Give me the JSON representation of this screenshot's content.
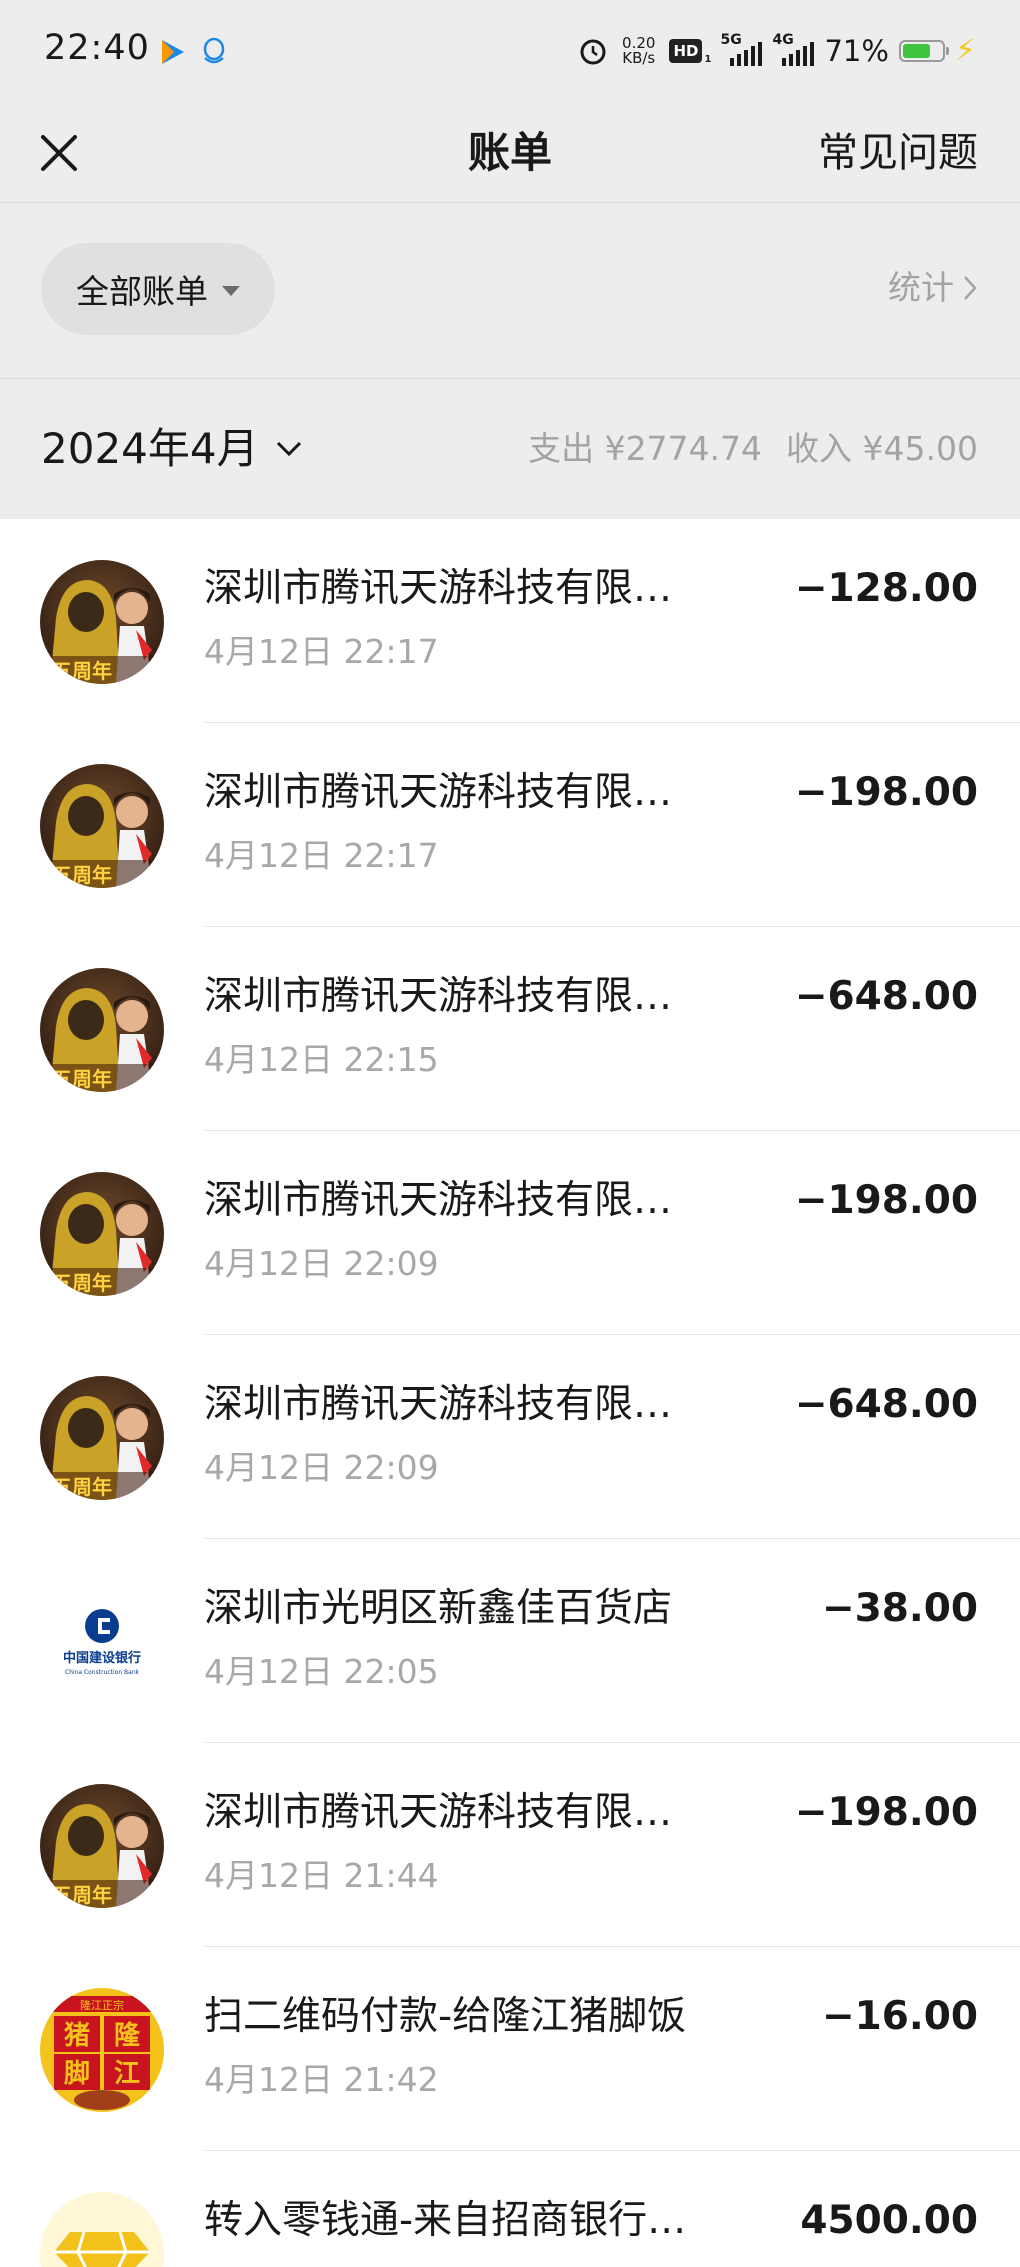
{
  "status_bar": {
    "time": "22:40",
    "net_speed_value": "0.20",
    "net_speed_unit": "KB/s",
    "hd_label": "HD",
    "hd_sub": "1",
    "signal_5g": "5G",
    "signal_4g": "4G",
    "battery_percent": "71%",
    "battery_level": 0.71
  },
  "navbar": {
    "title": "账单",
    "faq_label": "常见问题"
  },
  "filter": {
    "label": "全部账单",
    "stats_label": "统计"
  },
  "month": {
    "label": "2024年4月",
    "expense": "支出 ¥2774.74",
    "income": "收入 ¥45.00"
  },
  "transactions": [
    {
      "avatar": "game-avatar-icon",
      "name": "深圳市腾讯天游科技有限…",
      "time": "4月12日 22:17",
      "amount": "−128.00"
    },
    {
      "avatar": "game-avatar-icon",
      "name": "深圳市腾讯天游科技有限…",
      "time": "4月12日 22:17",
      "amount": "−198.00"
    },
    {
      "avatar": "game-avatar-icon",
      "name": "深圳市腾讯天游科技有限…",
      "time": "4月12日 22:15",
      "amount": "−648.00"
    },
    {
      "avatar": "game-avatar-icon",
      "name": "深圳市腾讯天游科技有限…",
      "time": "4月12日 22:09",
      "amount": "−198.00"
    },
    {
      "avatar": "game-avatar-icon",
      "name": "深圳市腾讯天游科技有限…",
      "time": "4月12日 22:09",
      "amount": "−648.00"
    },
    {
      "avatar": "ccb-bank-logo-icon",
      "name": "深圳市光明区新鑫佳百货店",
      "time": "4月12日 22:05",
      "amount": "−38.00"
    },
    {
      "avatar": "game-avatar-icon",
      "name": "深圳市腾讯天游科技有限…",
      "time": "4月12日 21:44",
      "amount": "−198.00"
    },
    {
      "avatar": "restaurant-logo-icon",
      "name": "扫二维码付款-给隆江猪脚饭",
      "time": "4月12日 21:42",
      "amount": "−16.00"
    },
    {
      "avatar": "diamond-icon",
      "name": "转入零钱通-来自招商银行…",
      "time": "",
      "amount": "4500.00"
    }
  ],
  "logos": {
    "game_badge": "五周年",
    "ccb_name": "中国建设银行",
    "ccb_en": "China Construction Bank",
    "restaurant_top": "隆江正宗",
    "restaurant_chars": [
      "猪",
      "隆",
      "脚",
      "江"
    ]
  },
  "colors": {
    "page_bg": "#ededed",
    "list_bg": "#ffffff",
    "secondary_text": "#a8a8a8",
    "battery_green": "#3ec43e",
    "bolt_yellow": "#f3c623",
    "ccb_blue": "#0a3d8f",
    "restaurant_red": "#c8141e",
    "restaurant_yellow": "#f4c21b",
    "diamond_gold": "#f2c21a"
  }
}
